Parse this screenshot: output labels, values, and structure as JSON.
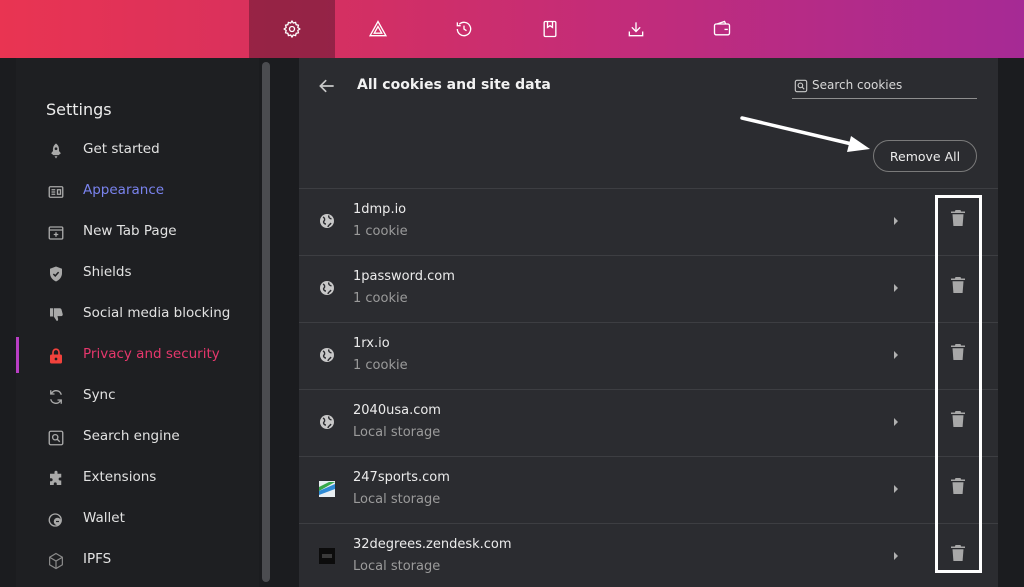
{
  "toolbar": {
    "buttons": [
      {
        "icon": "gear-icon",
        "active": true
      },
      {
        "icon": "brave-rewards-icon"
      },
      {
        "icon": "history-icon"
      },
      {
        "icon": "bookmarks-icon"
      },
      {
        "icon": "downloads-icon"
      },
      {
        "icon": "wallet-icon"
      }
    ],
    "colors": {
      "gradient_start": "#e93452",
      "gradient_end": "#a62a95"
    }
  },
  "sidebar": {
    "title": "Settings",
    "items": [
      {
        "label": "Get started",
        "icon": "rocket-icon"
      },
      {
        "label": "Appearance",
        "icon": "appearance-icon",
        "state": "highlighted"
      },
      {
        "label": "New Tab Page",
        "icon": "new-tab-icon"
      },
      {
        "label": "Shields",
        "icon": "shield-icon"
      },
      {
        "label": "Social media blocking",
        "icon": "thumbs-down-icon"
      },
      {
        "label": "Privacy and security",
        "icon": "lock-icon",
        "state": "active"
      },
      {
        "label": "Sync",
        "icon": "sync-icon"
      },
      {
        "label": "Search engine",
        "icon": "search-engine-icon"
      },
      {
        "label": "Extensions",
        "icon": "puzzle-icon"
      },
      {
        "label": "Wallet",
        "icon": "wallet-icon"
      },
      {
        "label": "IPFS",
        "icon": "ipfs-icon"
      }
    ],
    "colors": {
      "highlight": "#7a83ee",
      "active": "#e5376c"
    }
  },
  "main": {
    "title": "All cookies and site data",
    "search": {
      "placeholder": "Search cookies",
      "value": ""
    },
    "remove_all_label": "Remove All",
    "sites": [
      {
        "name": "1dmp.io",
        "detail": "1 cookie",
        "icon": "globe-icon"
      },
      {
        "name": "1password.com",
        "detail": "1 cookie",
        "icon": "globe-icon"
      },
      {
        "name": "1rx.io",
        "detail": "1 cookie",
        "icon": "globe-icon"
      },
      {
        "name": "2040usa.com",
        "detail": "Local storage",
        "icon": "globe-icon"
      },
      {
        "name": "247sports.com",
        "detail": "Local storage",
        "icon": "site-favicon"
      },
      {
        "name": "32degrees.zendesk.com",
        "detail": "Local storage",
        "icon": "site-favicon"
      }
    ]
  }
}
